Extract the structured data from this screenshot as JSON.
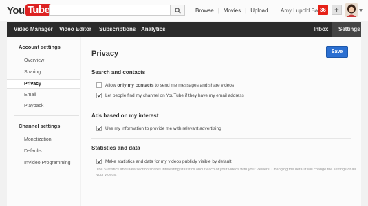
{
  "masthead": {
    "logo_you": "You",
    "logo_tube": "Tube",
    "search_placeholder": "",
    "links": [
      "Browse",
      "Movies",
      "Upload"
    ],
    "username": "Amy Lupold Bair",
    "notification_count": "36",
    "plus_label": "+"
  },
  "nav": {
    "video_manager": "Video Manager",
    "video_editor": "Video Editor",
    "subscriptions": "Subscriptions",
    "analytics": "Analytics",
    "inbox": "Inbox",
    "settings": "Settings"
  },
  "sidebar": {
    "account_heading": "Account settings",
    "account_items": [
      "Overview",
      "Sharing",
      "Privacy",
      "Email",
      "Playback"
    ],
    "active_item": "Privacy",
    "channel_heading": "Channel settings",
    "channel_items": [
      "Monetization",
      "Defaults",
      "InVideo Programming"
    ]
  },
  "main": {
    "title": "Privacy",
    "save_label": "Save",
    "search_section": {
      "title": "Search and contacts",
      "opt1_pre": "Allow ",
      "opt1_bold": "only my contacts",
      "opt1_post": " to send me messages and share videos",
      "opt1_checked": false,
      "opt2": "Let people find my channel on YouTube if they have my email address",
      "opt2_checked": true
    },
    "ads_section": {
      "title": "Ads based on my interest",
      "opt1": "Use my information to provide me with relevant advertising",
      "opt1_checked": true
    },
    "stats_section": {
      "title": "Statistics and data",
      "opt1": "Make statistics and data for my videos publicly visible by default",
      "opt1_checked": true,
      "help": "The Statistics and Data section shares interesting statistics about each of your videos with your viewers. Changing the default will change the settings of all your videos."
    }
  },
  "colors": {
    "brand_red": "#d22",
    "nav_bg": "#2b2b2b",
    "save_blue": "#2b6fd1",
    "notif_red": "#e62117"
  }
}
